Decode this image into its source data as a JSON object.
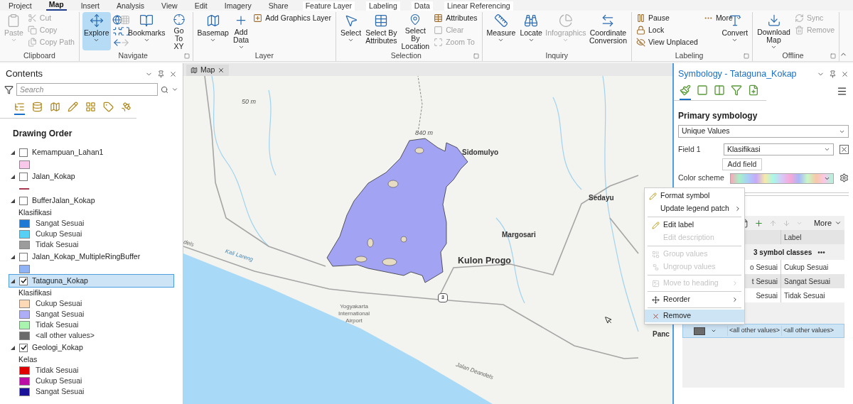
{
  "ribbon": {
    "tabs": [
      {
        "label": "Project",
        "selected": false,
        "kind": "core"
      },
      {
        "label": "Map",
        "selected": true,
        "kind": "core"
      },
      {
        "label": "Insert",
        "selected": false,
        "kind": "core"
      },
      {
        "label": "Analysis",
        "selected": false,
        "kind": "core"
      },
      {
        "label": "View",
        "selected": false,
        "kind": "core"
      },
      {
        "label": "Edit",
        "selected": false,
        "kind": "core"
      },
      {
        "label": "Imagery",
        "selected": false,
        "kind": "core"
      },
      {
        "label": "Share",
        "selected": false,
        "kind": "core"
      },
      {
        "label": "Feature Layer",
        "selected": false,
        "kind": "contextual"
      },
      {
        "label": "Labeling",
        "selected": false,
        "kind": "contextual"
      },
      {
        "label": "Data",
        "selected": false,
        "kind": "contextual"
      },
      {
        "label": "Linear Referencing",
        "selected": false,
        "kind": "contextual"
      }
    ],
    "groups": [
      {
        "label": "Clipboard",
        "launcher": false,
        "items": [
          {
            "kind": "large",
            "label": "Paste",
            "disabled": true,
            "selected": false,
            "dropdown": true
          },
          {
            "kind": "small",
            "label": "Cut",
            "disabled": true,
            "selected": false,
            "dropdown": false
          },
          {
            "kind": "small",
            "label": "Copy",
            "disabled": true,
            "selected": false,
            "dropdown": false
          },
          {
            "kind": "small",
            "label": "Copy Path",
            "disabled": true,
            "selected": false,
            "dropdown": false
          }
        ]
      },
      {
        "label": "Navigate",
        "launcher": true,
        "items": [
          {
            "kind": "large",
            "label": "Explore",
            "disabled": false,
            "selected": true,
            "dropdown": true
          },
          {
            "kind": "icon_grid"
          },
          {
            "kind": "large",
            "label": "Bookmarks",
            "disabled": false,
            "selected": false,
            "dropdown": true
          },
          {
            "kind": "large",
            "label": "Go To XY",
            "disabled": false,
            "selected": false,
            "dropdown": false
          }
        ]
      },
      {
        "label": "Layer",
        "launcher": false,
        "items": [
          {
            "kind": "large",
            "label": "Basemap",
            "disabled": false,
            "selected": false,
            "dropdown": true
          },
          {
            "kind": "large",
            "label": "Add Data",
            "disabled": false,
            "selected": false,
            "dropdown": true
          },
          {
            "kind": "small",
            "label": "Add Graphics Layer",
            "disabled": false,
            "selected": false,
            "dropdown": false
          }
        ]
      },
      {
        "label": "Selection",
        "launcher": true,
        "items": [
          {
            "kind": "large",
            "label": "Select",
            "disabled": false,
            "selected": false,
            "dropdown": true
          },
          {
            "kind": "large",
            "label": "Select By Attributes",
            "disabled": false,
            "selected": false,
            "dropdown": false
          },
          {
            "kind": "large",
            "label": "Select By Location",
            "disabled": false,
            "selected": false,
            "dropdown": false
          },
          {
            "kind": "small",
            "label": "Attributes",
            "disabled": false,
            "selected": false,
            "dropdown": false
          },
          {
            "kind": "small",
            "label": "Clear",
            "disabled": true,
            "selected": false,
            "dropdown": false
          },
          {
            "kind": "small",
            "label": "Zoom To",
            "disabled": true,
            "selected": false,
            "dropdown": false
          }
        ]
      },
      {
        "label": "Inquiry",
        "launcher": false,
        "items": [
          {
            "kind": "large",
            "label": "Measure",
            "disabled": false,
            "selected": false,
            "dropdown": true
          },
          {
            "kind": "large",
            "label": "Locate",
            "disabled": false,
            "selected": false,
            "dropdown": true
          },
          {
            "kind": "large",
            "label": "Infographics",
            "disabled": true,
            "selected": false,
            "dropdown": true
          },
          {
            "kind": "large",
            "label": "Coordinate Conversion",
            "disabled": false,
            "selected": false,
            "dropdown": false
          }
        ]
      },
      {
        "label": "Labeling",
        "launcher": true,
        "items": [
          {
            "kind": "small",
            "label": "Pause",
            "disabled": false,
            "selected": false,
            "dropdown": false
          },
          {
            "kind": "small",
            "label": "Lock",
            "disabled": false,
            "selected": false,
            "dropdown": false
          },
          {
            "kind": "small",
            "label": "View Unplaced",
            "disabled": false,
            "selected": false,
            "dropdown": false
          },
          {
            "kind": "small",
            "label": "More",
            "disabled": false,
            "selected": false,
            "dropdown": true
          },
          {
            "kind": "large",
            "label": "Convert",
            "disabled": false,
            "selected": false,
            "dropdown": true
          }
        ]
      },
      {
        "label": "Offline",
        "launcher": true,
        "items": [
          {
            "kind": "large",
            "label": "Download Map",
            "disabled": false,
            "selected": false,
            "dropdown": true
          },
          {
            "kind": "small",
            "label": "Sync",
            "disabled": true,
            "selected": false,
            "dropdown": false
          },
          {
            "kind": "small",
            "label": "Remove",
            "disabled": true,
            "selected": false,
            "dropdown": false
          }
        ]
      }
    ]
  },
  "contents": {
    "title": "Contents",
    "search": {
      "placeholder": "Search"
    },
    "view_tabs": [
      {
        "selected": true
      },
      {
        "selected": false
      },
      {
        "selected": false
      },
      {
        "selected": false
      },
      {
        "selected": false
      },
      {
        "selected": false
      },
      {
        "selected": false
      }
    ],
    "heading": "Drawing Order",
    "layers": [
      {
        "name": "Kemampuan_Lahan1",
        "checked": false,
        "selected": false,
        "expanded": true,
        "legend": [
          {
            "kind": "fill",
            "color": "#f9c9ec"
          }
        ]
      },
      {
        "name": "Jalan_Kokap",
        "checked": false,
        "selected": false,
        "expanded": true,
        "legend": [
          {
            "kind": "line",
            "color": "#a8394f"
          }
        ]
      },
      {
        "name": "BufferJalan_Kokap",
        "checked": false,
        "selected": false,
        "expanded": true,
        "legend_heading": "Klasifikasi",
        "legend": [
          {
            "kind": "fill",
            "label": "Sangat Sesuai",
            "color": "#1f7ad6"
          },
          {
            "kind": "fill",
            "label": "Cukup Sesuai",
            "color": "#57d0f5"
          },
          {
            "kind": "fill",
            "label": "Tidak Sesuai",
            "color": "#9c9c9c"
          }
        ]
      },
      {
        "name": "Jalan_Kokap_MultipleRingBuffer",
        "checked": false,
        "selected": false,
        "expanded": true,
        "legend": [
          {
            "kind": "fill",
            "color": "#8fb3f5"
          }
        ]
      },
      {
        "name": "Tataguna_Kokap",
        "checked": true,
        "selected": true,
        "expanded": true,
        "legend_heading": "Klasifikasi",
        "legend": [
          {
            "kind": "fill",
            "label": "Cukup Sesuai",
            "color": "#fdd9b5"
          },
          {
            "kind": "fill",
            "label": "Sangat Sesuai",
            "color": "#aeaef6"
          },
          {
            "kind": "fill",
            "label": "Tidak Sesuai",
            "color": "#a9f5b0"
          },
          {
            "kind": "fill",
            "label": "<all other values>",
            "color": "#6b6b6b"
          }
        ]
      },
      {
        "name": "Geologi_Kokap",
        "checked": true,
        "selected": false,
        "expanded": true,
        "legend_heading": "Kelas",
        "legend": [
          {
            "kind": "fill",
            "label": "Tidak Sesuai",
            "color": "#e00000"
          },
          {
            "kind": "fill",
            "label": "Cukup Sesuai",
            "color": "#bb0da6"
          },
          {
            "kind": "fill",
            "label": "Sangat Sesuai",
            "color": "#1a1299"
          }
        ]
      }
    ]
  },
  "map_view": {
    "tab": "Map",
    "labels": [
      {
        "kind": "elevation",
        "text": "50 m"
      },
      {
        "kind": "elevation",
        "text": "840 m"
      },
      {
        "kind": "place",
        "text": "Sidomulyo"
      },
      {
        "kind": "place",
        "text": "Sedayu"
      },
      {
        "kind": "place",
        "text": "Margosari"
      },
      {
        "kind": "region",
        "text": "Kulon Progo"
      },
      {
        "kind": "water",
        "text": "Kali Lareng"
      },
      {
        "kind": "road",
        "text": "dels"
      },
      {
        "kind": "poi",
        "text": "Yogyakarta International Airport"
      },
      {
        "kind": "shield",
        "text": "3"
      },
      {
        "kind": "road",
        "text": "Jalan Deandels"
      },
      {
        "kind": "place",
        "text": "Panc"
      }
    ]
  },
  "symbology": {
    "title": "Symbology - Tataguna_Kokap",
    "tabs": [
      {
        "selected": true
      },
      {
        "selected": false
      },
      {
        "selected": false
      },
      {
        "selected": false
      },
      {
        "selected": false
      }
    ],
    "section": "Primary symbology",
    "method": "Unique Values",
    "field_label": "Field 1",
    "field_value": "Klasifikasi",
    "add_field": "Add field",
    "color_scheme_label": "Color scheme",
    "more": "More",
    "columns": [
      "Label"
    ],
    "heading_row": "3 symbol classes",
    "heading_more": "•••",
    "rows": [
      {
        "value": "o Sesuai",
        "label": "Cukup Sesuai",
        "selected": false
      },
      {
        "value": "t Sesuai",
        "label": "Sangat Sesuai",
        "selected": true
      },
      {
        "value": "Sesuai",
        "label": "Tidak Sesuai",
        "selected": false
      }
    ],
    "other_row": {
      "color": "#6b6b6b",
      "value": "<all other values>",
      "label": "<all other values>",
      "selected": true
    }
  },
  "context_menu": {
    "groups": [
      [
        {
          "label": "Format symbol",
          "kind": "pencil",
          "disabled": false,
          "submenu": false,
          "selected": false
        },
        {
          "label": "Update legend patch",
          "kind": "none",
          "disabled": false,
          "submenu": true,
          "selected": false
        }
      ],
      [
        {
          "label": "Edit label",
          "kind": "pencil",
          "disabled": false,
          "submenu": false,
          "selected": false
        },
        {
          "label": "Edit description",
          "kind": "none",
          "disabled": true,
          "submenu": false,
          "selected": false
        }
      ],
      [
        {
          "label": "Group values",
          "kind": "group",
          "disabled": true,
          "submenu": false,
          "selected": false
        },
        {
          "label": "Ungroup values",
          "kind": "ungroup",
          "disabled": true,
          "submenu": false,
          "selected": false
        }
      ],
      [
        {
          "label": "Move to heading",
          "kind": "heading",
          "disabled": true,
          "submenu": true,
          "selected": false
        }
      ],
      [
        {
          "label": "Reorder",
          "kind": "move",
          "disabled": false,
          "submenu": true,
          "selected": false
        }
      ],
      [
        {
          "label": "Remove",
          "kind": "remove",
          "disabled": false,
          "submenu": false,
          "selected": true
        }
      ]
    ]
  }
}
